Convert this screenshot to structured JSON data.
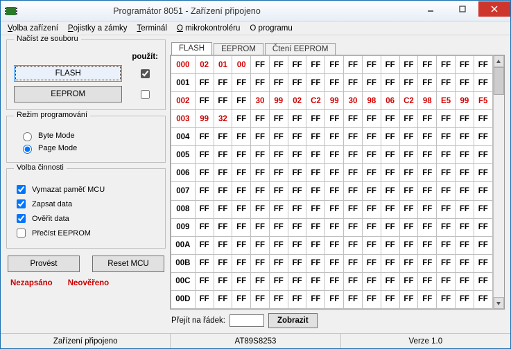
{
  "title": "Programátor 8051 - Zařízení připojeno",
  "menu": {
    "volba": {
      "u": "V",
      "rest": "olba zařízení"
    },
    "pojistky": {
      "u": "P",
      "rest": "ojistky a zámky"
    },
    "terminal": {
      "u": "T",
      "rest": "erminál"
    },
    "omikro": {
      "u": "O",
      "rest": " mikrokontroléru"
    },
    "oprogramu": "O programu"
  },
  "groups": {
    "load": {
      "legend": "Načíst ze souboru",
      "use_label": "použít:",
      "flash_btn": "FLASH",
      "eeprom_btn": "EEPROM",
      "flash_chk": true,
      "eeprom_chk": false
    },
    "mode": {
      "legend": "Režim programování",
      "byte": "Byte Mode",
      "page": "Page Mode",
      "selected": "page"
    },
    "ops": {
      "legend": "Volba činnosti",
      "erase": {
        "label": "Vymazat paměť MCU",
        "checked": true
      },
      "write": {
        "label": "Zapsat data",
        "checked": true
      },
      "verify": {
        "label": "Ověřit data",
        "checked": true
      },
      "read": {
        "label": "Přečíst EEPROM",
        "checked": false
      }
    }
  },
  "actions": {
    "execute": "Provést",
    "reset": "Reset MCU"
  },
  "status_left": {
    "nezapsano": "Nezapsáno",
    "neovereno": "Neověřeno"
  },
  "tabs": {
    "flash": "FLASH",
    "eeprom": "EEPROM",
    "read_eeprom": "Čtení EEPROM",
    "active": "flash"
  },
  "goto": {
    "label": "Přejít na řádek:",
    "value": "",
    "button": "Zobrazit"
  },
  "statusbar": {
    "conn": "Zařízení připojeno",
    "chip": "AT89S8253",
    "ver": "Verze 1.0"
  },
  "hex": {
    "rows": [
      {
        "addr": "000",
        "addr_red": true,
        "cells": [
          {
            "v": "02",
            "r": true
          },
          {
            "v": "01",
            "r": true
          },
          {
            "v": "00",
            "r": true
          },
          {
            "v": "FF"
          },
          {
            "v": "FF"
          },
          {
            "v": "FF"
          },
          {
            "v": "FF"
          },
          {
            "v": "FF"
          },
          {
            "v": "FF"
          },
          {
            "v": "FF"
          },
          {
            "v": "FF"
          },
          {
            "v": "FF"
          },
          {
            "v": "FF"
          },
          {
            "v": "FF"
          },
          {
            "v": "FF"
          },
          {
            "v": "FF"
          }
        ]
      },
      {
        "addr": "001",
        "cells": [
          {
            "v": "FF"
          },
          {
            "v": "FF"
          },
          {
            "v": "FF"
          },
          {
            "v": "FF"
          },
          {
            "v": "FF"
          },
          {
            "v": "FF"
          },
          {
            "v": "FF"
          },
          {
            "v": "FF"
          },
          {
            "v": "FF"
          },
          {
            "v": "FF"
          },
          {
            "v": "FF"
          },
          {
            "v": "FF"
          },
          {
            "v": "FF"
          },
          {
            "v": "FF"
          },
          {
            "v": "FF"
          },
          {
            "v": "FF"
          }
        ]
      },
      {
        "addr": "002",
        "addr_red": true,
        "cells": [
          {
            "v": "FF"
          },
          {
            "v": "FF"
          },
          {
            "v": "FF"
          },
          {
            "v": "30",
            "r": true
          },
          {
            "v": "99",
            "r": true
          },
          {
            "v": "02",
            "r": true
          },
          {
            "v": "C2",
            "r": true
          },
          {
            "v": "99",
            "r": true
          },
          {
            "v": "30",
            "r": true
          },
          {
            "v": "98",
            "r": true
          },
          {
            "v": "06",
            "r": true
          },
          {
            "v": "C2",
            "r": true
          },
          {
            "v": "98",
            "r": true
          },
          {
            "v": "E5",
            "r": true
          },
          {
            "v": "99",
            "r": true
          },
          {
            "v": "F5",
            "r": true
          }
        ]
      },
      {
        "addr": "003",
        "addr_red": true,
        "cells": [
          {
            "v": "99",
            "r": true
          },
          {
            "v": "32",
            "r": true
          },
          {
            "v": "FF"
          },
          {
            "v": "FF"
          },
          {
            "v": "FF"
          },
          {
            "v": "FF"
          },
          {
            "v": "FF"
          },
          {
            "v": "FF"
          },
          {
            "v": "FF"
          },
          {
            "v": "FF"
          },
          {
            "v": "FF"
          },
          {
            "v": "FF"
          },
          {
            "v": "FF"
          },
          {
            "v": "FF"
          },
          {
            "v": "FF"
          },
          {
            "v": "FF"
          }
        ]
      },
      {
        "addr": "004",
        "cells": [
          {
            "v": "FF"
          },
          {
            "v": "FF"
          },
          {
            "v": "FF"
          },
          {
            "v": "FF"
          },
          {
            "v": "FF"
          },
          {
            "v": "FF"
          },
          {
            "v": "FF"
          },
          {
            "v": "FF"
          },
          {
            "v": "FF"
          },
          {
            "v": "FF"
          },
          {
            "v": "FF"
          },
          {
            "v": "FF"
          },
          {
            "v": "FF"
          },
          {
            "v": "FF"
          },
          {
            "v": "FF"
          },
          {
            "v": "FF"
          }
        ]
      },
      {
        "addr": "005",
        "cells": [
          {
            "v": "FF"
          },
          {
            "v": "FF"
          },
          {
            "v": "FF"
          },
          {
            "v": "FF"
          },
          {
            "v": "FF"
          },
          {
            "v": "FF"
          },
          {
            "v": "FF"
          },
          {
            "v": "FF"
          },
          {
            "v": "FF"
          },
          {
            "v": "FF"
          },
          {
            "v": "FF"
          },
          {
            "v": "FF"
          },
          {
            "v": "FF"
          },
          {
            "v": "FF"
          },
          {
            "v": "FF"
          },
          {
            "v": "FF"
          }
        ]
      },
      {
        "addr": "006",
        "cells": [
          {
            "v": "FF"
          },
          {
            "v": "FF"
          },
          {
            "v": "FF"
          },
          {
            "v": "FF"
          },
          {
            "v": "FF"
          },
          {
            "v": "FF"
          },
          {
            "v": "FF"
          },
          {
            "v": "FF"
          },
          {
            "v": "FF"
          },
          {
            "v": "FF"
          },
          {
            "v": "FF"
          },
          {
            "v": "FF"
          },
          {
            "v": "FF"
          },
          {
            "v": "FF"
          },
          {
            "v": "FF"
          },
          {
            "v": "FF"
          }
        ]
      },
      {
        "addr": "007",
        "cells": [
          {
            "v": "FF"
          },
          {
            "v": "FF"
          },
          {
            "v": "FF"
          },
          {
            "v": "FF"
          },
          {
            "v": "FF"
          },
          {
            "v": "FF"
          },
          {
            "v": "FF"
          },
          {
            "v": "FF"
          },
          {
            "v": "FF"
          },
          {
            "v": "FF"
          },
          {
            "v": "FF"
          },
          {
            "v": "FF"
          },
          {
            "v": "FF"
          },
          {
            "v": "FF"
          },
          {
            "v": "FF"
          },
          {
            "v": "FF"
          }
        ]
      },
      {
        "addr": "008",
        "cells": [
          {
            "v": "FF"
          },
          {
            "v": "FF"
          },
          {
            "v": "FF"
          },
          {
            "v": "FF"
          },
          {
            "v": "FF"
          },
          {
            "v": "FF"
          },
          {
            "v": "FF"
          },
          {
            "v": "FF"
          },
          {
            "v": "FF"
          },
          {
            "v": "FF"
          },
          {
            "v": "FF"
          },
          {
            "v": "FF"
          },
          {
            "v": "FF"
          },
          {
            "v": "FF"
          },
          {
            "v": "FF"
          },
          {
            "v": "FF"
          }
        ]
      },
      {
        "addr": "009",
        "cells": [
          {
            "v": "FF"
          },
          {
            "v": "FF"
          },
          {
            "v": "FF"
          },
          {
            "v": "FF"
          },
          {
            "v": "FF"
          },
          {
            "v": "FF"
          },
          {
            "v": "FF"
          },
          {
            "v": "FF"
          },
          {
            "v": "FF"
          },
          {
            "v": "FF"
          },
          {
            "v": "FF"
          },
          {
            "v": "FF"
          },
          {
            "v": "FF"
          },
          {
            "v": "FF"
          },
          {
            "v": "FF"
          },
          {
            "v": "FF"
          }
        ]
      },
      {
        "addr": "00A",
        "cells": [
          {
            "v": "FF"
          },
          {
            "v": "FF"
          },
          {
            "v": "FF"
          },
          {
            "v": "FF"
          },
          {
            "v": "FF"
          },
          {
            "v": "FF"
          },
          {
            "v": "FF"
          },
          {
            "v": "FF"
          },
          {
            "v": "FF"
          },
          {
            "v": "FF"
          },
          {
            "v": "FF"
          },
          {
            "v": "FF"
          },
          {
            "v": "FF"
          },
          {
            "v": "FF"
          },
          {
            "v": "FF"
          },
          {
            "v": "FF"
          }
        ]
      },
      {
        "addr": "00B",
        "cells": [
          {
            "v": "FF"
          },
          {
            "v": "FF"
          },
          {
            "v": "FF"
          },
          {
            "v": "FF"
          },
          {
            "v": "FF"
          },
          {
            "v": "FF"
          },
          {
            "v": "FF"
          },
          {
            "v": "FF"
          },
          {
            "v": "FF"
          },
          {
            "v": "FF"
          },
          {
            "v": "FF"
          },
          {
            "v": "FF"
          },
          {
            "v": "FF"
          },
          {
            "v": "FF"
          },
          {
            "v": "FF"
          },
          {
            "v": "FF"
          }
        ]
      },
      {
        "addr": "00C",
        "cells": [
          {
            "v": "FF"
          },
          {
            "v": "FF"
          },
          {
            "v": "FF"
          },
          {
            "v": "FF"
          },
          {
            "v": "FF"
          },
          {
            "v": "FF"
          },
          {
            "v": "FF"
          },
          {
            "v": "FF"
          },
          {
            "v": "FF"
          },
          {
            "v": "FF"
          },
          {
            "v": "FF"
          },
          {
            "v": "FF"
          },
          {
            "v": "FF"
          },
          {
            "v": "FF"
          },
          {
            "v": "FF"
          },
          {
            "v": "FF"
          }
        ]
      },
      {
        "addr": "00D",
        "cells": [
          {
            "v": "FF"
          },
          {
            "v": "FF"
          },
          {
            "v": "FF"
          },
          {
            "v": "FF"
          },
          {
            "v": "FF"
          },
          {
            "v": "FF"
          },
          {
            "v": "FF"
          },
          {
            "v": "FF"
          },
          {
            "v": "FF"
          },
          {
            "v": "FF"
          },
          {
            "v": "FF"
          },
          {
            "v": "FF"
          },
          {
            "v": "FF"
          },
          {
            "v": "FF"
          },
          {
            "v": "FF"
          },
          {
            "v": "FF"
          }
        ]
      }
    ]
  }
}
